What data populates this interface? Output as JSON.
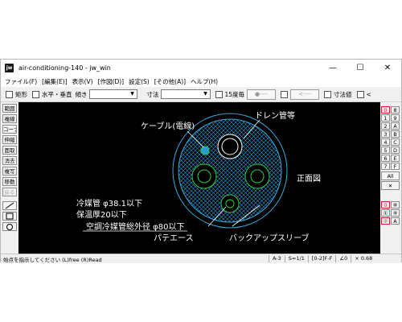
{
  "window": {
    "title": "air-conditioning-140 - jw_win",
    "app_icon_label": "jw",
    "controls": {
      "minimize": "—",
      "maximize": "☐",
      "close": "✕"
    }
  },
  "menu": [
    "ファイル(F)",
    "[編集(E)]",
    "表示(V)",
    "[作図(D)]",
    "設定(S)",
    "[その他(A)]",
    "ヘルプ(H)"
  ],
  "toolbar": {
    "rect_label": "矩形",
    "hv_label": "水平・垂直",
    "angle_label": "傾き",
    "dim_label": "寸法",
    "deg15_label": "15度毎",
    "btn1_label": "●----",
    "btn2_label": "<----",
    "dimval_label": "寸法値",
    "lt_label": "<"
  },
  "left_tools": [
    "範囲",
    "複線",
    "コーナー",
    "伸縮",
    "面取",
    "消去",
    "複写",
    "移動",
    "戻る"
  ],
  "right_tools": {
    "rows": [
      [
        "0",
        "8"
      ],
      [
        "1",
        "9"
      ],
      [
        "2",
        "A"
      ],
      [
        "3",
        "B"
      ],
      [
        "4",
        "C"
      ],
      [
        "5",
        "D"
      ],
      [
        "6",
        "E"
      ],
      [
        "7",
        "F"
      ]
    ],
    "all_label": "All",
    "x_label": "✕",
    "bottom_rows": [
      [
        "0",
        "⑧"
      ],
      [
        "①",
        "⑨"
      ],
      [
        "②",
        "A"
      ]
    ]
  },
  "drawing": {
    "cable_label": "ケーブル(電線)",
    "drain_label": "ドレン管等",
    "front_label": "正面図",
    "pipe_spec_line1": "冷媒管 φ38.1以下",
    "pipe_spec_line2": "保温厚20以下",
    "pipe_spec_line3": "空調冷媒管総外径 φ80以下",
    "putty_label": "パテエース",
    "backup_label": "バックアップスリーブ"
  },
  "status": {
    "message": "始点を指示してください (L)free (R)Read",
    "paper": "A-3",
    "scale": "S=1/1",
    "layer": "[0-2]F-F",
    "angle": "∠0",
    "zoom": "× 0.68"
  }
}
